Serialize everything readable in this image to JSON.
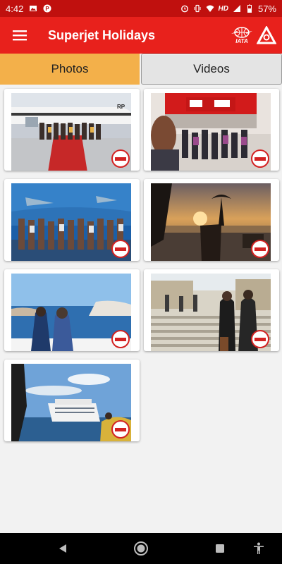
{
  "status": {
    "time": "4:42",
    "network": "HD",
    "battery": "57%"
  },
  "appbar": {
    "title": "Superjet Holidays",
    "iata_label": "IATA"
  },
  "tabs": [
    {
      "label": "Photos"
    },
    {
      "label": "Videos"
    }
  ],
  "colors": {
    "appbar": "#e8211c",
    "statusbar": "#c0100e",
    "active_tab": "#f3b04a"
  },
  "photos": [
    {
      "name": "photo-airplane-group"
    },
    {
      "name": "photo-ferrari-world-group"
    },
    {
      "name": "photo-aquarium-group"
    },
    {
      "name": "photo-sunset-lake"
    },
    {
      "name": "photo-santorini-sea"
    },
    {
      "name": "photo-steps-two-women"
    },
    {
      "name": "photo-cruise-ship"
    }
  ]
}
